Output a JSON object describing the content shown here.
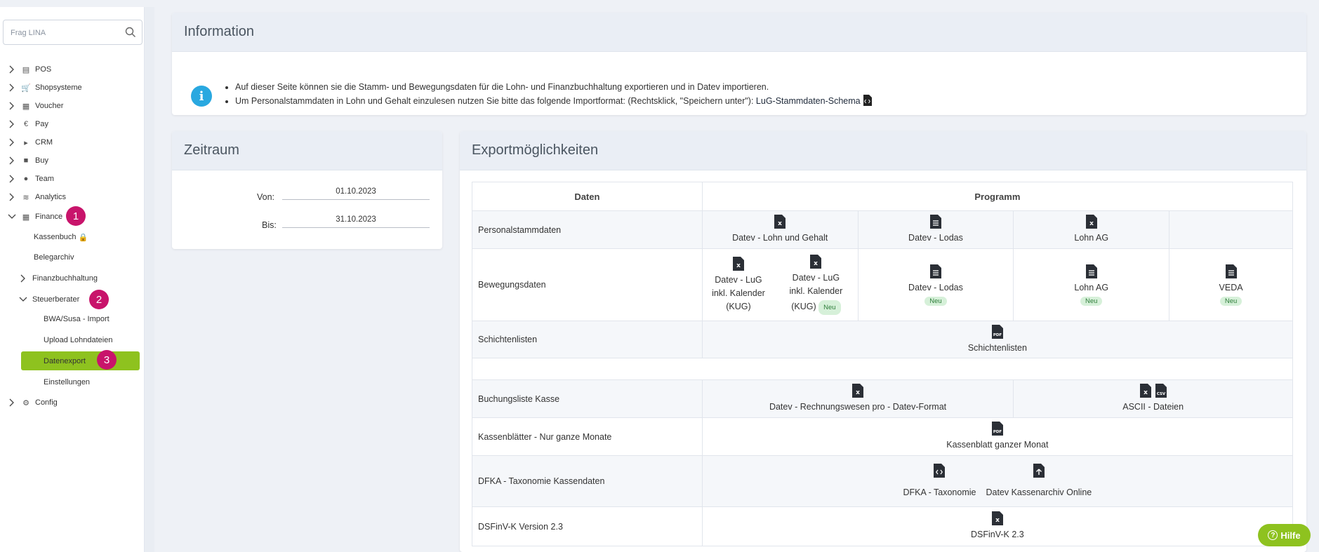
{
  "sidebar": {
    "search_placeholder": "Frag LINA",
    "items": [
      {
        "label": "POS",
        "icon": "cash-register-icon"
      },
      {
        "label": "Shopsysteme",
        "icon": "cart-icon"
      },
      {
        "label": "Voucher",
        "icon": "gift-icon"
      },
      {
        "label": "Pay",
        "icon": "euro-icon"
      },
      {
        "label": "CRM",
        "icon": "megaphone-icon"
      },
      {
        "label": "Buy",
        "icon": "truck-icon"
      },
      {
        "label": "Team",
        "icon": "users-icon"
      },
      {
        "label": "Analytics",
        "icon": "chart-icon"
      },
      {
        "label": "Finance",
        "icon": "calculator-icon"
      }
    ],
    "finance_children": {
      "kassenbuch": "Kassenbuch",
      "belegarchiv": "Belegarchiv",
      "finanzbuchhaltung": "Finanzbuchhaltung",
      "steuerberater": "Steuerberater"
    },
    "steuerberater_children": {
      "bwa": "BWA/Susa - Import",
      "upload": "Upload Lohndateien",
      "datenexport": "Datenexport",
      "einstellungen": "Einstellungen"
    },
    "config": "Config",
    "steps": [
      "1",
      "2",
      "3"
    ]
  },
  "information": {
    "title": "Information",
    "line1": "Auf dieser Seite können sie die Stamm- und Bewegungsdaten für die Lohn- und Finanzbuchhaltung exportieren und in Datev importieren.",
    "line2": "Um Personalstammdaten in Lohn und Gehalt einzulesen nutzen Sie bitte das folgende Importformat: (Rechtsklick, \"Speichern unter\"):",
    "schema_link": "LuG-Stammdaten-Schema"
  },
  "zeitraum": {
    "title": "Zeitraum",
    "von_label": "Von:",
    "von_value": "01.10.2023",
    "bis_label": "Bis:",
    "bis_value": "31.10.2023"
  },
  "export": {
    "title": "Exportmöglichkeiten",
    "col_daten": "Daten",
    "col_programm": "Programm",
    "rows": {
      "personal": {
        "label": "Personalstammdaten",
        "p1": "Datev - Lohn und Gehalt",
        "p2": "Datev - Lodas",
        "p3": "Lohn AG"
      },
      "bewegung": {
        "label": "Bewegungsdaten",
        "p1a": "Datev - LuG",
        "p1b": "inkl. Kalender",
        "p1c": "(KUG)",
        "p2a": "Datev - LuG",
        "p2b": "inkl. Kalender",
        "p2c": "(KUG)",
        "p3": "Datev - Lodas",
        "p4": "Lohn AG",
        "p5": "VEDA",
        "neu": "Neu"
      },
      "schicht": {
        "label": "Schichtenlisten",
        "p1": "Schichtenlisten"
      },
      "buchung": {
        "label": "Buchungsliste Kasse",
        "p1": "Datev - Rechnungswesen pro - Datev-Format",
        "p2": "ASCII - Dateien"
      },
      "kassenblatt": {
        "label": "Kassenblätter - Nur ganze Monate",
        "p1": "Kassenblatt ganzer Monat"
      },
      "dfka": {
        "label": "DFKA - Taxonomie Kassendaten",
        "p1": "DFKA - Taxonomie",
        "p2": "Datev Kassenarchiv Online"
      },
      "dsfinv": {
        "label": "DSFinV-K Version 2.3",
        "p1": "DSFinV-K 2.3"
      }
    }
  },
  "help": {
    "label": "Hilfe"
  },
  "colors": {
    "accent": "#8ec21f",
    "step_badge": "#c8146b",
    "info": "#29a8e0"
  }
}
